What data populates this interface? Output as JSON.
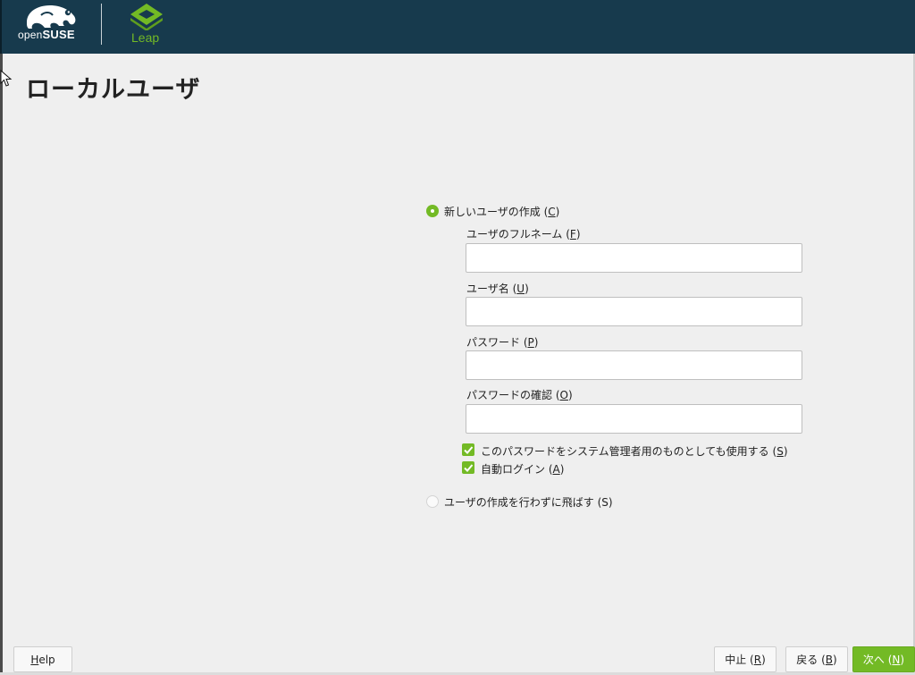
{
  "header": {
    "brand_open": "open",
    "brand_suse": "SUSE",
    "product": "Leap",
    "icons": [
      "chameleon-logo-icon",
      "leap-logo-icon"
    ]
  },
  "page": {
    "title": "ローカルユーザ"
  },
  "options": {
    "create_user": {
      "label": "新しいユーザの作成 (",
      "key": "C",
      "suffix": ")",
      "selected": true
    },
    "skip_user": {
      "label": "ユーザの作成を行わずに飛ばす (S)",
      "selected": false
    }
  },
  "fields": {
    "full_name": {
      "label": "ユーザのフルネーム (",
      "key": "F",
      "suffix": ")",
      "value": ""
    },
    "username": {
      "label": "ユーザ名 (",
      "key": "U",
      "suffix": ")",
      "value": ""
    },
    "password": {
      "label": "パスワード (",
      "key": "P",
      "suffix": ")",
      "value": ""
    },
    "password_confirm": {
      "label": "パスワードの確認 (",
      "key": "O",
      "suffix": ")",
      "value": ""
    }
  },
  "checkboxes": {
    "admin_password": {
      "label": "このパスワードをシステム管理者用のものとしても使用する (",
      "key": "S",
      "suffix": ")",
      "checked": true
    },
    "autologin": {
      "label": "自動ログイン (",
      "key": "A",
      "suffix": ")",
      "checked": true
    }
  },
  "buttons": {
    "help": {
      "key": "H",
      "rest": "elp"
    },
    "abort": {
      "label": "中止 (",
      "key": "R",
      "suffix": ")"
    },
    "back": {
      "label": "戻る (",
      "key": "B",
      "suffix": ")"
    },
    "next": {
      "label": "次へ (",
      "key": "N",
      "suffix": ")"
    }
  },
  "colors": {
    "header": "#173a4d",
    "accent": "#73ba25",
    "background": "#efefef"
  }
}
